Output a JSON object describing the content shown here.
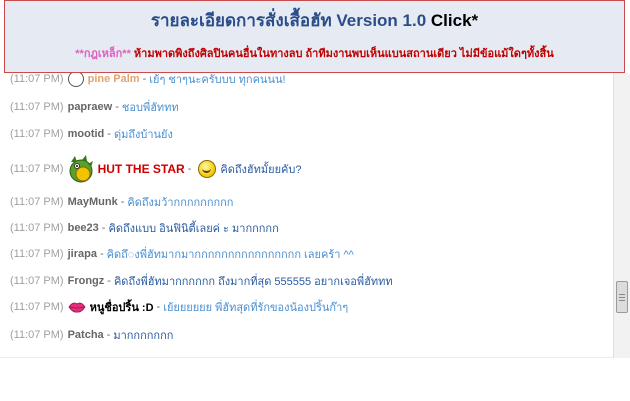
{
  "banner": {
    "title": "รายละเอียดการสั่งเสื้อฮัท Version 1.0 ",
    "click_label": "Click*",
    "rule_tag": "**กฎเหล็ก**",
    "rule_text": " ห้ามพาดพิงถึงศิลปินคนอื่นในทางลบ ถ้าทีมงานพบเห็นแบนสถานเดียว ไม่มีข้อแม้ใดๆทั้งสิ้น"
  },
  "chat": {
    "messages": [
      {
        "time": "(11:07 PM)",
        "name": "pine Palm",
        "text": "เย้ๆ ชาๆนะครับบบ ทุกคนนน!"
      },
      {
        "time": "(11:07 PM)",
        "name": "papraew",
        "text": "ชอบพี่ฮัททท"
      },
      {
        "time": "(11:07 PM)",
        "name": "mootid",
        "text": "ดุ่มถึงบ้านยัง"
      },
      {
        "time": "(11:07 PM)",
        "name": "HUT THE STAR",
        "text": "คิดถึงฮัทมั้ยยคับ?"
      },
      {
        "time": "(11:07 PM)",
        "name": "MayMunk",
        "text": "คิดถึงมว้ากกกกกกกกก"
      },
      {
        "time": "(11:07 PM)",
        "name": "bee23",
        "text": "คิดถึงแบบ อินฟินิตี้เลยค่ ะ มากกกกก"
      },
      {
        "time": "(11:07 PM)",
        "name": "jirapa",
        "text": "คิดถึ◌งพี่ฮัทมากมากกกกกกกกกกกกกกกก เลยคร้า ^^"
      },
      {
        "time": "(11:07 PM)",
        "name": "Frongz",
        "text": "คิดถึงพี่ฮัทมากกกกกก ถึงมากที่สุด 555555 อยากเจอพี่ฮัททท"
      },
      {
        "time": "(11:07 PM)",
        "name": "หนูชื่อปริ้น :D",
        "text": "เย้ยยยยยย พี่ฮัทสุดที่รักของน้องปริ้นก๊าๆ"
      },
      {
        "time": "(11:07 PM)",
        "name": "Patcha",
        "text": "มากกกกกกก"
      }
    ],
    "separator": " - "
  },
  "icons": {
    "dragon": "dragon-avatar-icon",
    "smile": "smiley-icon",
    "lips": "lips-icon",
    "small": "small-avatar-icon"
  },
  "colors": {
    "banner_bg": "#e6ebf3",
    "title": "#2a4d8a",
    "rule": "#c00000",
    "time": "#a0a0a0",
    "name": "#666666",
    "message": "#4a8fd0",
    "hut_name": "#cc0000"
  }
}
